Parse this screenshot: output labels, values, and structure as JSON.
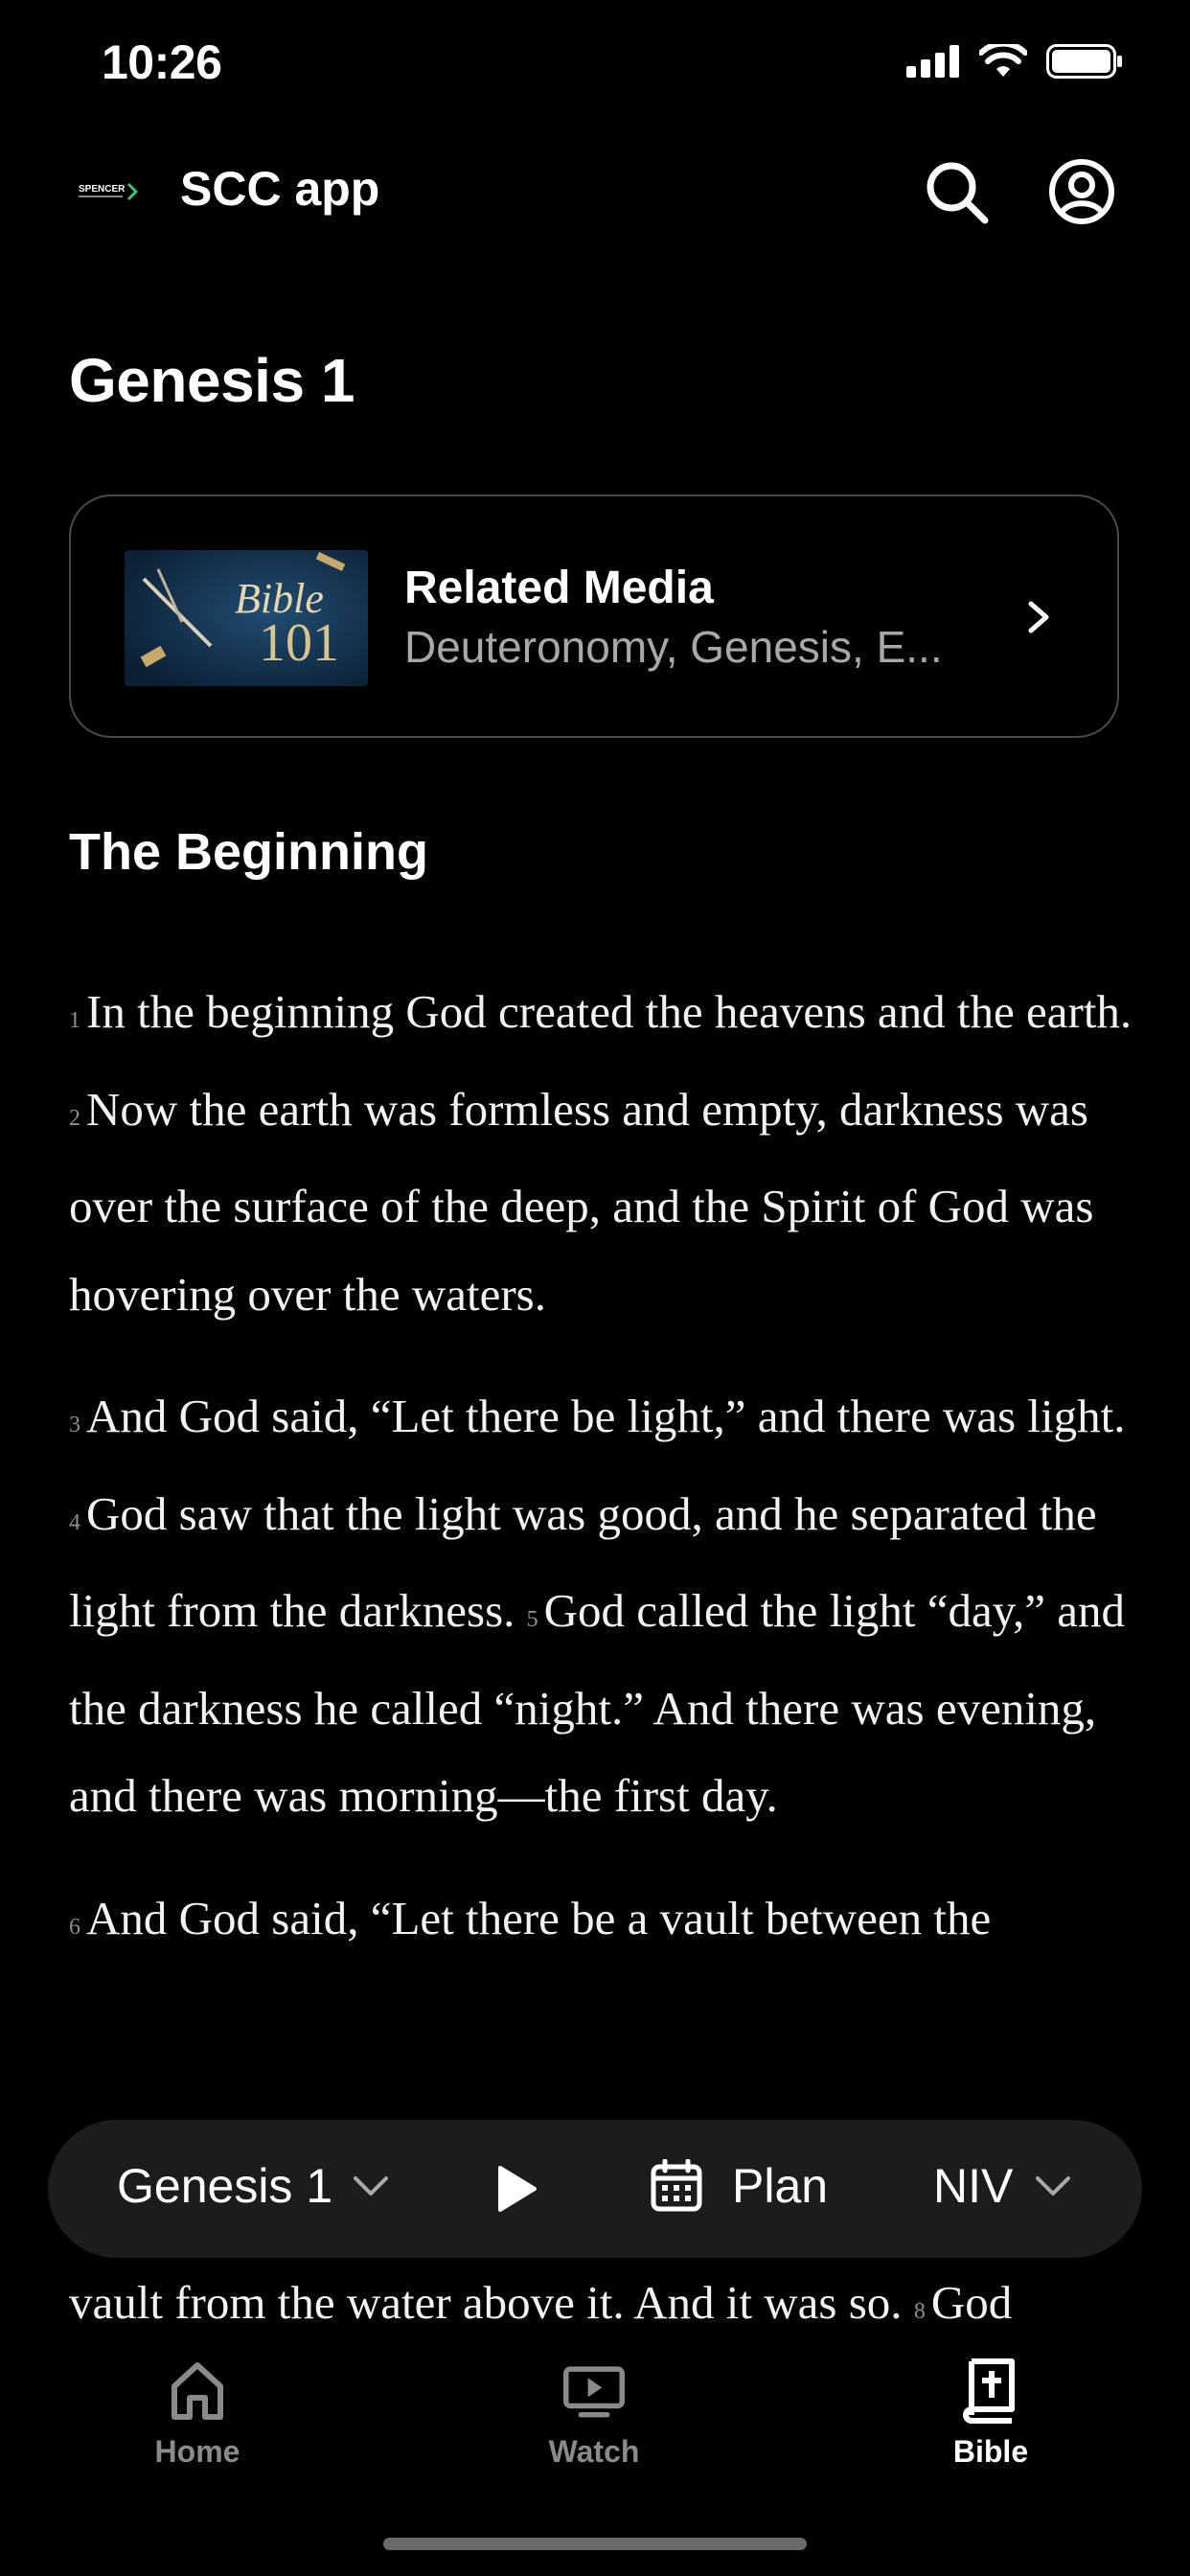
{
  "status_bar": {
    "time": "10:26"
  },
  "app_bar": {
    "title": "SCC app",
    "logo_text": "SPENCER"
  },
  "chapter": {
    "title": "Genesis 1"
  },
  "related_media": {
    "heading": "Related Media",
    "subtitle": "Deuteronomy, Genesis, E...",
    "thumbnail_text": "Bible 101"
  },
  "section": {
    "heading": "The Beginning"
  },
  "verses": {
    "v1": "In the beginning God created the heavens and the earth.",
    "v2": "Now the earth was formless and empty, darkness was over the surface of the deep, and the Spirit of God was hovering over the waters.",
    "v3": "And God said, “Let there be light,” and there was light.",
    "v4": "God saw that the light was good, and he separated the light from the darkness.",
    "v5": "God called the light “day,” and the darkness he called “night.” And there was evening, and there was morning—the first day.",
    "v6": "And God said, “Let there be a vault between the",
    "v7_tail": "vault from the water above it. And it was so.",
    "v8": "God",
    "n1": "1",
    "n2": "2",
    "n3": "3",
    "n4": "4",
    "n5": "5",
    "n6": "6",
    "n8": "8"
  },
  "reader_bar": {
    "chapter_label": "Genesis 1",
    "plan_label": "Plan",
    "version_label": "NIV"
  },
  "tab_bar": {
    "tabs": [
      {
        "label": "Home",
        "icon": "home-icon",
        "active": false
      },
      {
        "label": "Watch",
        "icon": "tv-icon",
        "active": false
      },
      {
        "label": "Bible",
        "icon": "bible-icon",
        "active": true
      }
    ]
  },
  "colors": {
    "background": "#000000",
    "text": "#ffffff",
    "muted": "#a8a8a8",
    "bar": "#1c1c1e"
  }
}
